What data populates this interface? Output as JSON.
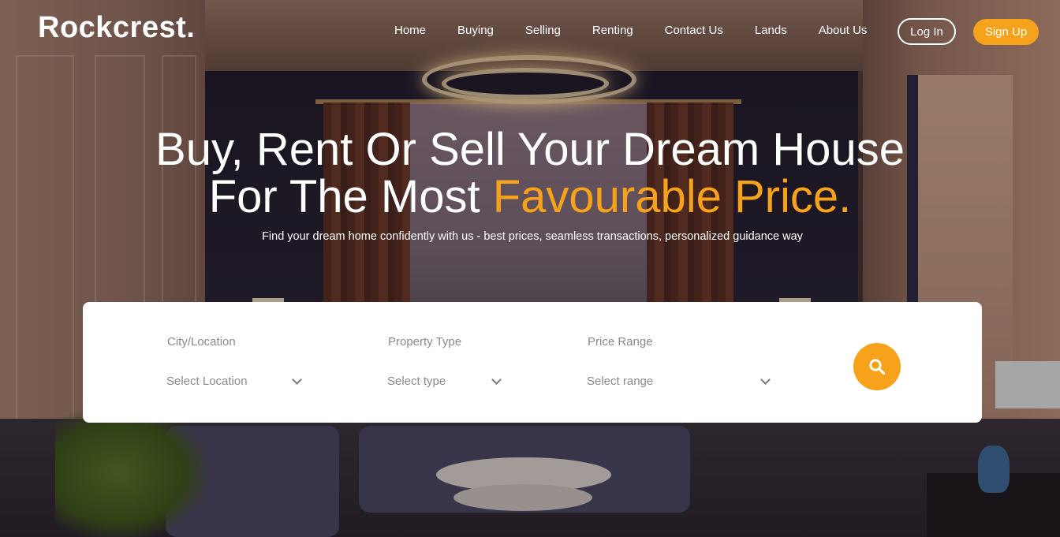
{
  "brand": {
    "name": "Rockcrest."
  },
  "nav": {
    "links": [
      "Home",
      "Buying",
      "Selling",
      "Renting",
      "Contact Us",
      "Lands",
      "About Us"
    ],
    "login_label": "Log In",
    "signup_label": "Sign Up"
  },
  "hero": {
    "title_line1": "Buy, Rent Or Sell Your Dream House",
    "title_line2_plain": "For The Most ",
    "title_line2_accent": "Favourable Price.",
    "subtitle": "Find your dream home confidently with us - best prices, seamless transactions, personalized guidance way"
  },
  "search": {
    "location": {
      "label": "City/Location",
      "selected": "Select Location"
    },
    "type": {
      "label": "Property Type",
      "selected": "Select type"
    },
    "price": {
      "label": "Price Range",
      "selected": "Select range"
    },
    "button_icon": "search-icon"
  },
  "colors": {
    "accent": "#f7a21b",
    "card": "#ffffff",
    "text_muted": "#8a8a8a"
  }
}
